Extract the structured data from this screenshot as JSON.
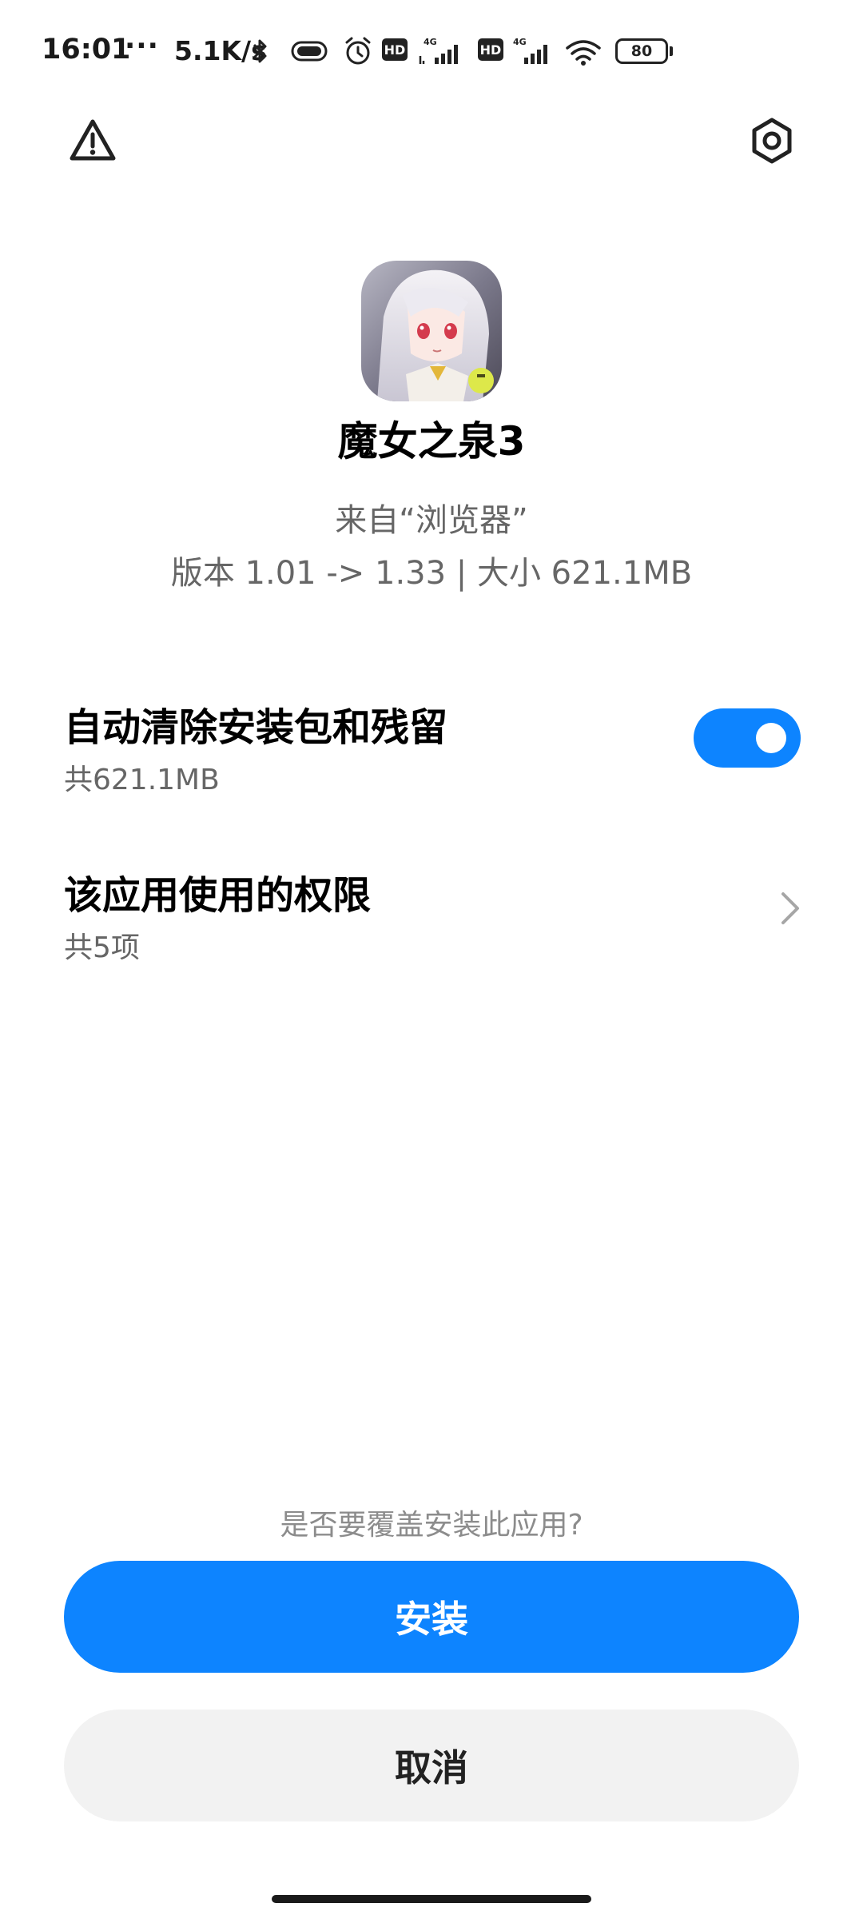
{
  "status_bar": {
    "time": "16:01",
    "dots": "···",
    "net_speed": "5.1K/s",
    "hd1": "HD",
    "hd2": "HD",
    "net1": "4G",
    "net2": "4G",
    "battery": "80",
    "icons": [
      "bluetooth-icon",
      "vibrate-icon",
      "alarm-icon",
      "signal-icon",
      "wifi-icon",
      "battery-icon"
    ]
  },
  "top_bar": {
    "left_icon": "warning-icon",
    "right_icon": "settings-icon"
  },
  "app": {
    "name": "魔女之泉3",
    "source": "来自“浏览器”",
    "version_size": "版本 1.01 -> 1.33 | 大小 621.1MB"
  },
  "options": {
    "auto_clean": {
      "title": "自动清除安装包和残留",
      "subtitle": "共621.1MB",
      "enabled": true
    },
    "permissions": {
      "title": "该应用使用的权限",
      "subtitle": "共5项"
    }
  },
  "prompt": "是否要覆盖安装此应用?",
  "buttons": {
    "install": "安装",
    "cancel": "取消"
  },
  "colors": {
    "accent": "#0d84ff",
    "cancel_bg": "#f2f2f2",
    "secondary_text": "#666666"
  }
}
